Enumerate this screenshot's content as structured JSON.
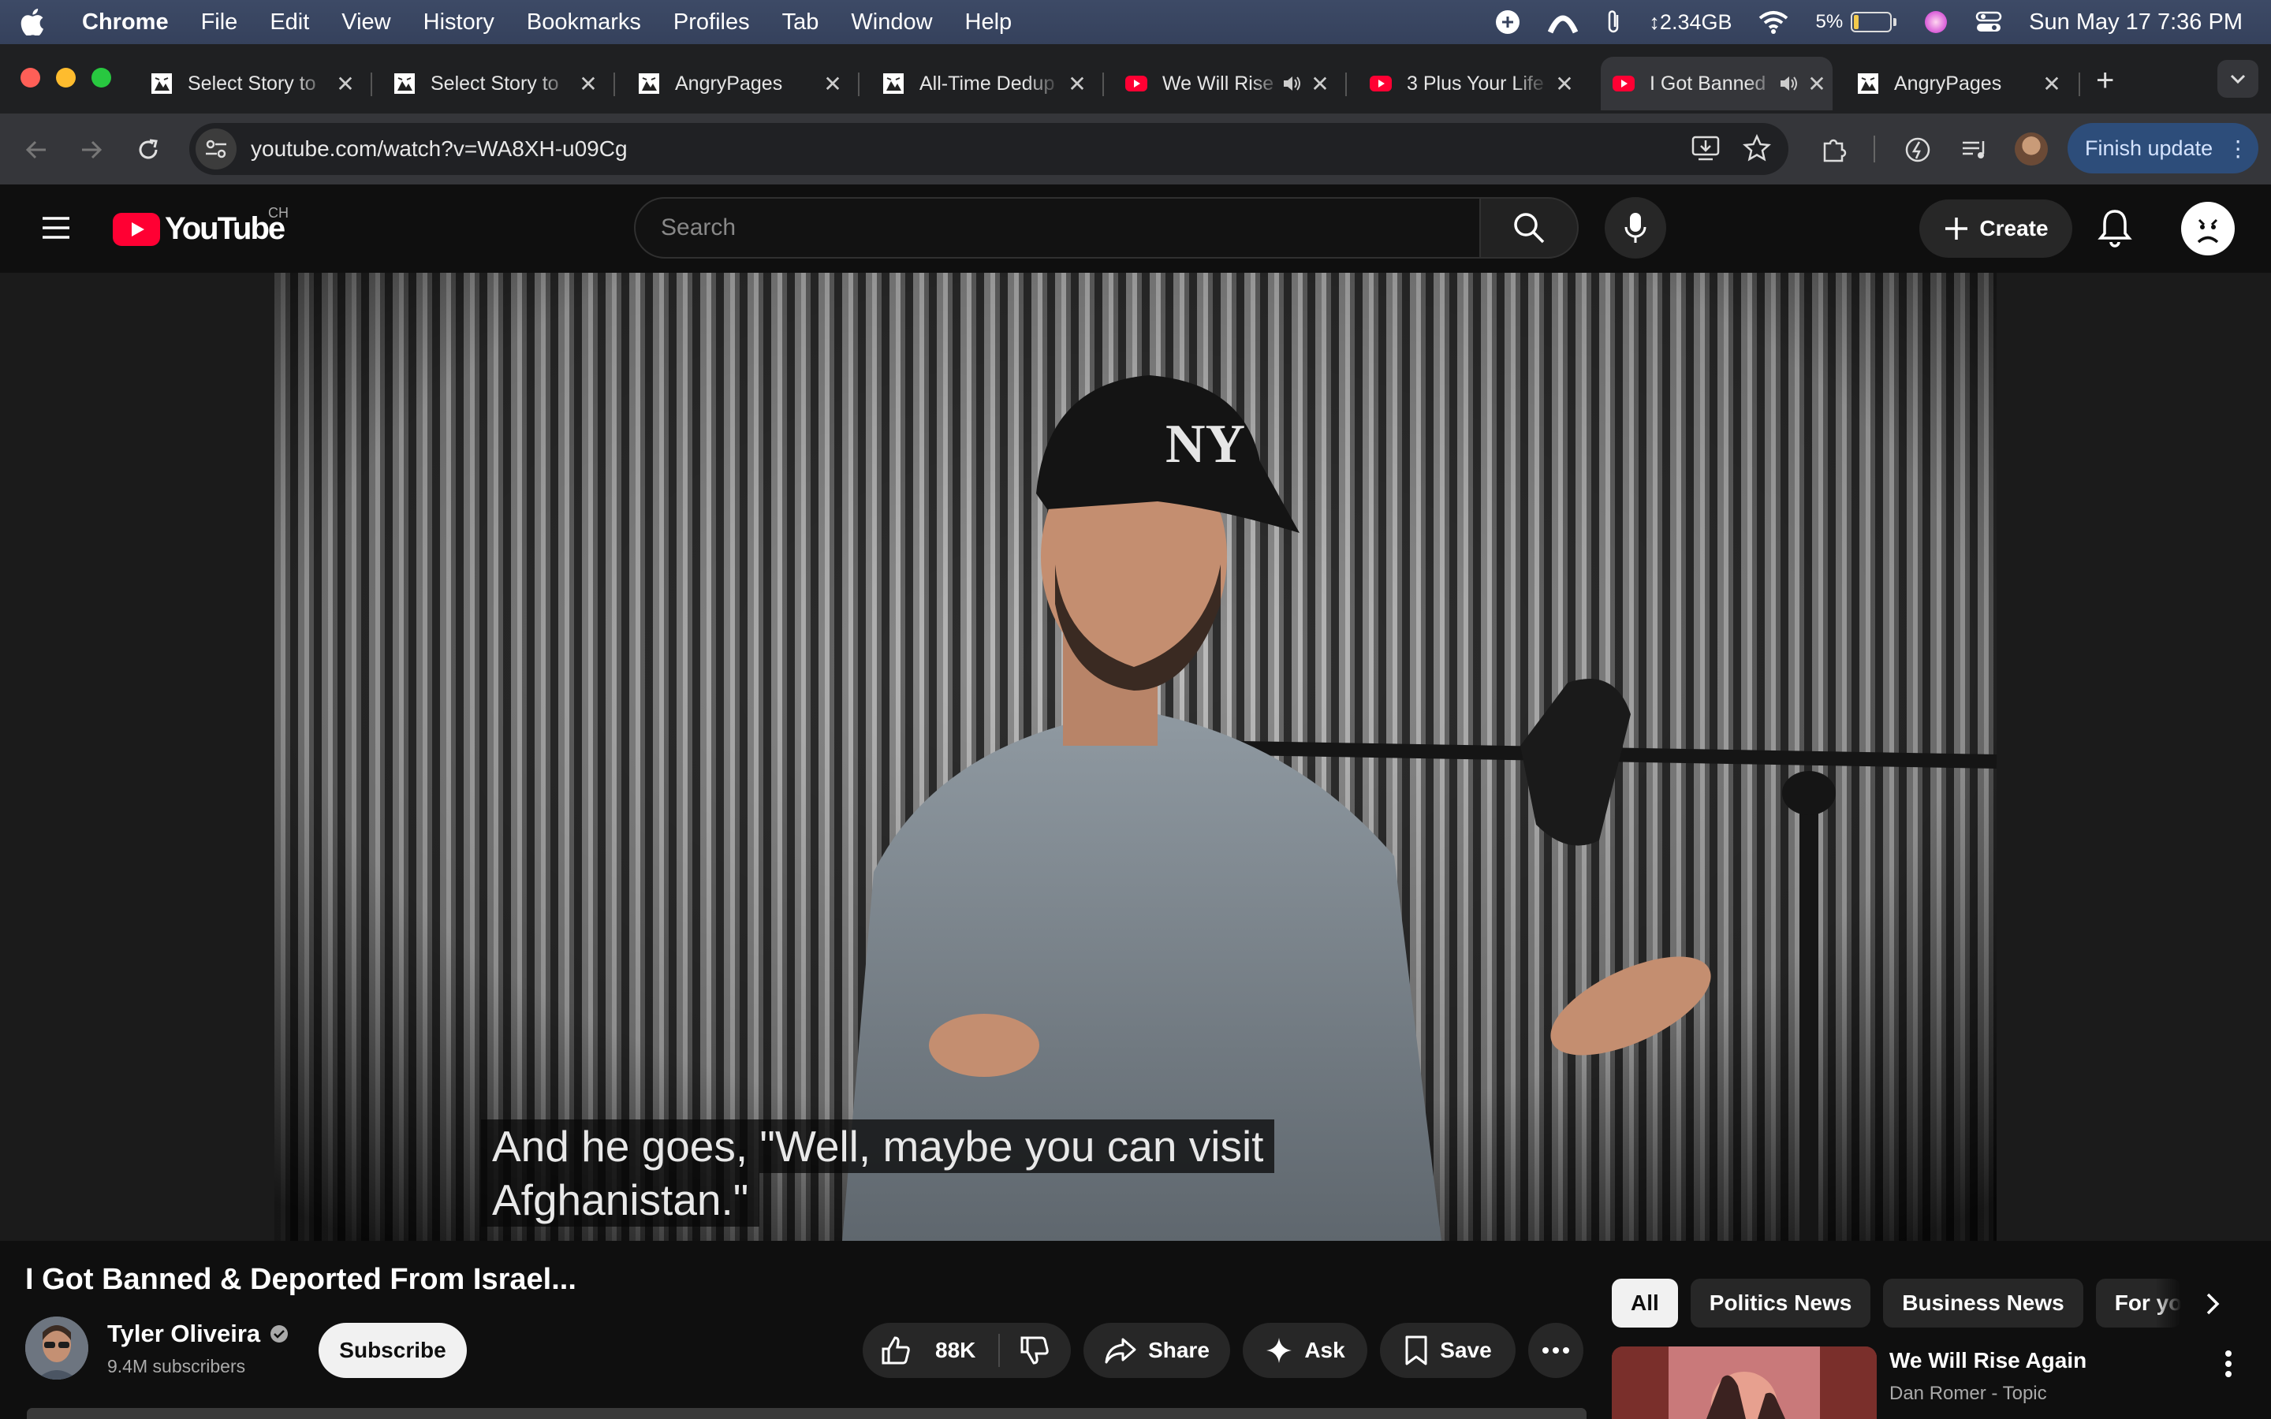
{
  "menubar": {
    "app_name": "Chrome",
    "items": [
      "File",
      "Edit",
      "View",
      "History",
      "Bookmarks",
      "Profiles",
      "Tab",
      "Window",
      "Help"
    ],
    "memory": "↕2.34GB",
    "battery_percent": "5%",
    "clock": "Sun May 17  7:36 PM"
  },
  "tabs": [
    {
      "title": "Select Story to"
    },
    {
      "title": "Select Story to"
    },
    {
      "title": "AngryPages"
    },
    {
      "title": "All-Time Dedup"
    },
    {
      "title": "We Will Rise"
    },
    {
      "title": "3 Plus Your Life"
    },
    {
      "title": "I Got Banned"
    },
    {
      "title": "AngryPages"
    }
  ],
  "toolbar": {
    "url": "youtube.com/watch?v=WA8XH-u09Cg",
    "finish_update": "Finish update"
  },
  "youtube": {
    "logo_text": "YouTube",
    "country_code": "CH",
    "search_placeholder": "Search",
    "create_label": "Create"
  },
  "video": {
    "caption_line1": "And he goes, \"Well, maybe you can visit",
    "caption_line2": "Afghanistan.\"",
    "title": "I Got Banned & Deported From Israel...",
    "channel_name": "Tyler Oliveira",
    "subscribers": "9.4M subscribers",
    "subscribe_label": "Subscribe",
    "likes": "88K",
    "share_label": "Share",
    "ask_label": "Ask",
    "save_label": "Save"
  },
  "chips": [
    "All",
    "Politics News",
    "Business News",
    "For you"
  ],
  "recommendation": {
    "title": "We Will Rise Again",
    "channel": "Dan Romer - Topic"
  },
  "colors": {
    "youtube_red": "#ff0033",
    "finish_update_bg": "#2d4d7a"
  }
}
